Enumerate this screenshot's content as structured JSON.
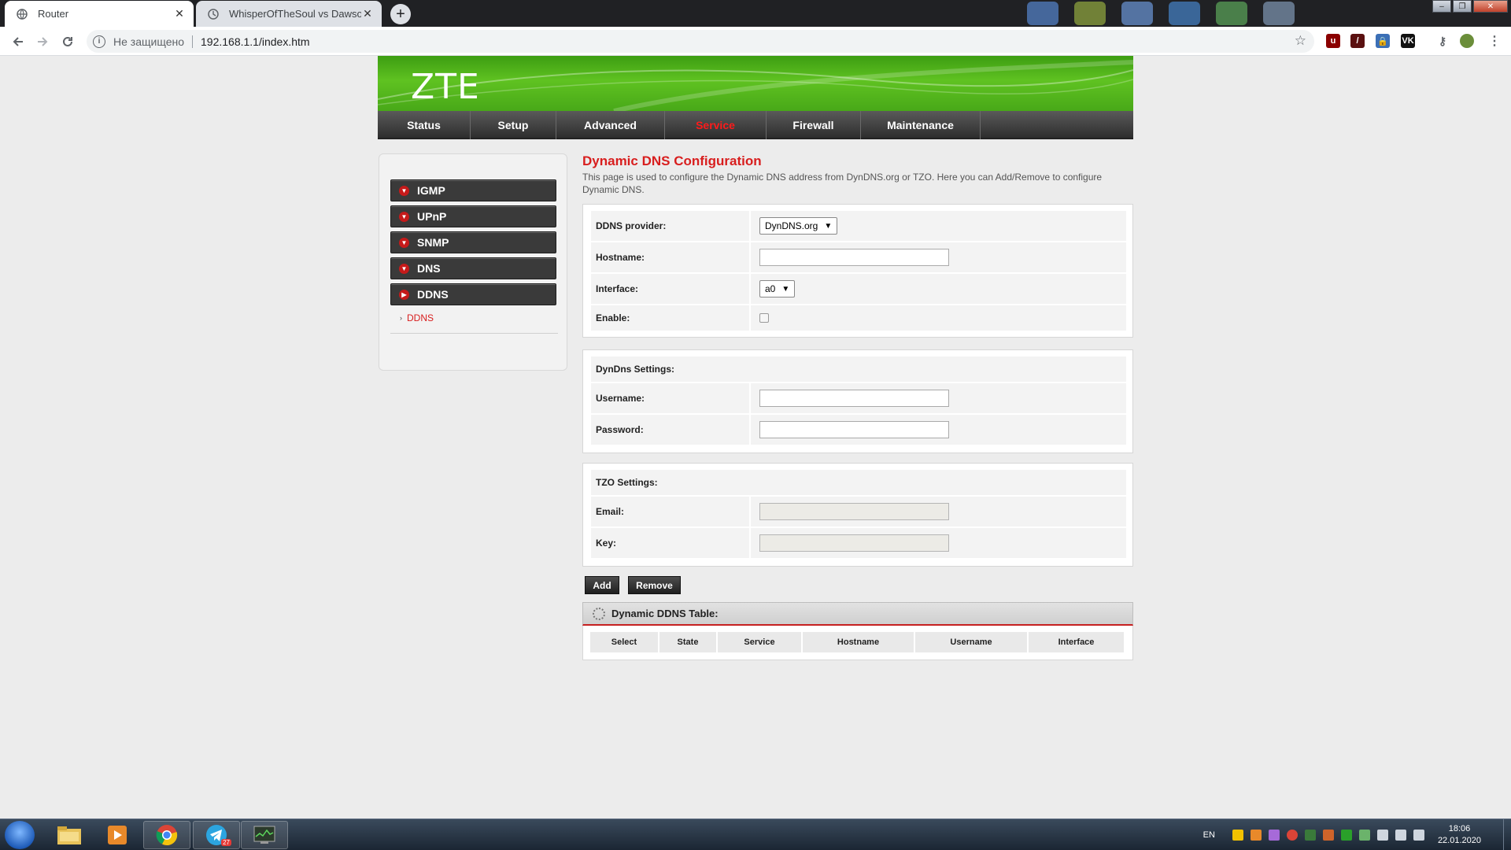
{
  "browser": {
    "tabs": [
      {
        "title": "Router",
        "active": true
      },
      {
        "title": "WhisperOfTheSoul vs DawsonRy",
        "active": false
      }
    ],
    "address": {
      "security_text": "Не защищено",
      "url": "192.168.1.1/index.htm"
    },
    "extensions": [
      "ublock-icon",
      "red-ext-icon",
      "lock-ext-icon",
      "vk-icon",
      "key-icon",
      "avatar-ext-icon"
    ]
  },
  "router": {
    "brand": "ZTE",
    "nav": [
      {
        "label": "Status",
        "active": false
      },
      {
        "label": "Setup",
        "active": false
      },
      {
        "label": "Advanced",
        "active": false
      },
      {
        "label": "Service",
        "active": true
      },
      {
        "label": "Firewall",
        "active": false
      },
      {
        "label": "Maintenance",
        "active": false
      }
    ],
    "sidebar": {
      "items": [
        {
          "label": "IGMP",
          "expanded": false
        },
        {
          "label": "UPnP",
          "expanded": false
        },
        {
          "label": "SNMP",
          "expanded": false
        },
        {
          "label": "DNS",
          "expanded": false
        },
        {
          "label": "DDNS",
          "expanded": true
        }
      ],
      "sub_items": [
        {
          "label": "DDNS",
          "active": true
        }
      ]
    },
    "page": {
      "title": "Dynamic DNS Configuration",
      "description": "This page is used to configure the Dynamic DNS address from DynDNS.org or TZO. Here you can Add/Remove to configure Dynamic DNS."
    },
    "form": {
      "provider_label": "DDNS provider:",
      "provider_value": "DynDNS.org",
      "hostname_label": "Hostname:",
      "hostname_value": "",
      "interface_label": "Interface:",
      "interface_value": "a0",
      "enable_label": "Enable:",
      "enable_checked": false
    },
    "dyndns": {
      "title": "DynDns Settings:",
      "username_label": "Username:",
      "username_value": "",
      "password_label": "Password:",
      "password_value": ""
    },
    "tzo": {
      "title": "TZO Settings:",
      "email_label": "Email:",
      "email_value": "",
      "key_label": "Key:",
      "key_value": ""
    },
    "buttons": {
      "add": "Add",
      "remove": "Remove"
    },
    "table": {
      "title": "Dynamic DDNS Table:",
      "columns": [
        "Select",
        "State",
        "Service",
        "Hostname",
        "Username",
        "Interface"
      ],
      "rows": []
    }
  },
  "taskbar": {
    "apps": [
      "start-orb",
      "explorer-icon",
      "media-player-icon",
      "chrome-icon",
      "telegram-icon",
      "task-manager-icon"
    ],
    "telegram_badge": "27",
    "lang": "EN",
    "time": "18:06",
    "date": "22.01.2020"
  },
  "colors": {
    "accent_red": "#d81e1e",
    "banner_green": "#4fb31b",
    "nav_dark": "#2e2e2e"
  }
}
